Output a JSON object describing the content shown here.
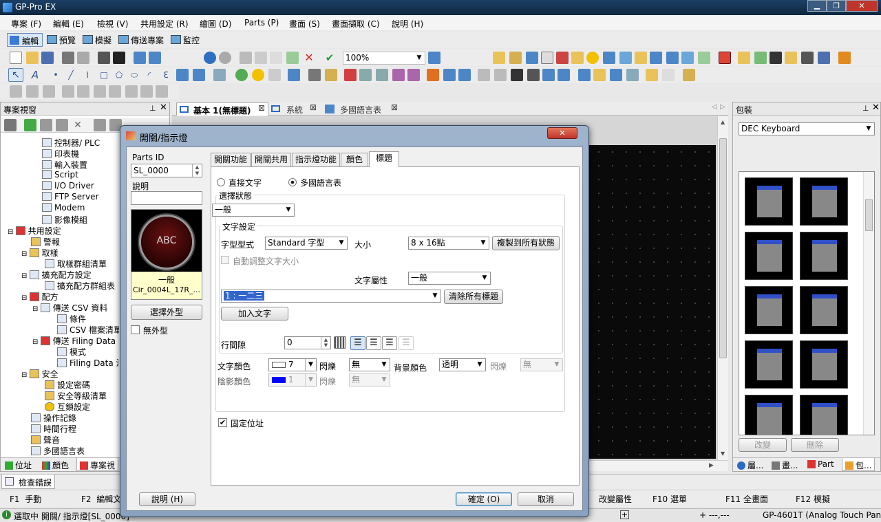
{
  "app": {
    "title": "GP-Pro EX"
  },
  "menu": [
    "專案 (F)",
    "編輯 (E)",
    "檢視 (V)",
    "共用設定 (R)",
    "繪圖 (D)",
    "Parts (P)",
    "畫面 (S)",
    "畫面擷取 (C)",
    "說明 (H)"
  ],
  "modebar": {
    "edit": "編輯",
    "preview": "預覽",
    "simulate": "模擬",
    "transfer": "傳送專案",
    "monitor": "監控"
  },
  "toolbar": {
    "zoom": "100%"
  },
  "project_pane": {
    "title": "專案視窗",
    "items": [
      "控制器/ PLC",
      "印表機",
      "輸入裝置",
      "Script",
      "I/O Driver",
      "FTP Server",
      "Modem",
      "影像模組",
      "共用設定",
      "警報",
      "取樣",
      "取樣群組清單",
      "擴充配方設定",
      "擴充配方群組表",
      "配方",
      "傳送 CSV 資料",
      "條件",
      "CSV 檔案清單",
      "傳送 Filing Data",
      "模式",
      "Filing Data 清單",
      "安全",
      "設定密碼",
      "安全等級清單",
      "互鎖設定",
      "操作記錄",
      "時間行程",
      "聲音",
      "多國語言表"
    ],
    "bottom_tabs": [
      "位址",
      "顏色",
      "專案視"
    ]
  },
  "doc_tabs": [
    "基本 1(無標題)",
    "系統",
    "多國語言表"
  ],
  "package_pane": {
    "title": "包裝",
    "selected": "DEC Keyboard",
    "buttons": {
      "modify": "改變",
      "delete": "刪除"
    },
    "bottom_tabs": [
      "屬...",
      "畫...",
      "Part",
      "包..."
    ]
  },
  "check_errors": "檢查錯誤",
  "fkeys": [
    {
      "key": "F1",
      "label": "手動"
    },
    {
      "key": "F2",
      "label": "編輯文"
    },
    {
      "key": "",
      "label": "改變屬性"
    },
    {
      "key": "F10",
      "label": "選單"
    },
    {
      "key": "F11",
      "label": "全畫面"
    },
    {
      "key": "F12",
      "label": "模擬"
    }
  ],
  "status": {
    "left": "選取中  開關/ 指示燈[SL_0000]",
    "model": "GP-4601T (Analog Touch Panel)",
    "coords": "+ ---,---"
  },
  "dialog": {
    "title": "開關/指示燈",
    "parts_id_label": "Parts ID",
    "parts_id": "SL_0000",
    "comment_label": "說明",
    "preview_caption": "ABC",
    "preview_state": "一般",
    "preview_name": "Cir_0004L_17R_...",
    "select_shape": "選擇外型",
    "no_shape": "無外型",
    "help": "說明 (H)",
    "ok": "確定 (O)",
    "cancel": "取消",
    "tabs": [
      "開關功能",
      "開關共用",
      "指示燈功能",
      "顏色",
      "標題"
    ],
    "radio_direct": "直接文字",
    "radio_multi": "多國語言表",
    "state_label": "選擇狀態",
    "state_value": "一般",
    "text_settings": "文字設定",
    "font_type_label": "字型型式",
    "font_type": "Standard 字型",
    "size_label": "大小",
    "size": "8 x 16點",
    "copy_all": "複製到所有狀態",
    "auto_size": "自動調整文字大小",
    "attr_label": "文字屬性",
    "attr_value": "一般",
    "label_value": "1 : 一二三",
    "clear_labels": "清除所有標題",
    "add_text": "加入文字",
    "line_spacing_label": "行間隙",
    "line_spacing": "0",
    "text_color_label": "文字顏色",
    "text_color": "7",
    "blink_label": "閃爍",
    "blink_value": "無",
    "bg_color_label": "背景顏色",
    "bg_color": "透明",
    "bg_blink_label": "閃爍",
    "bg_blink_value": "無",
    "shadow_label": "陰影顏色",
    "shadow_color": "1",
    "shadow_blink_label": "閃爍",
    "shadow_blink_value": "無",
    "fixed_pos": "固定位址",
    "colors": {
      "text_swatch": "#ffffff",
      "shadow_swatch": "#0000ff"
    }
  }
}
